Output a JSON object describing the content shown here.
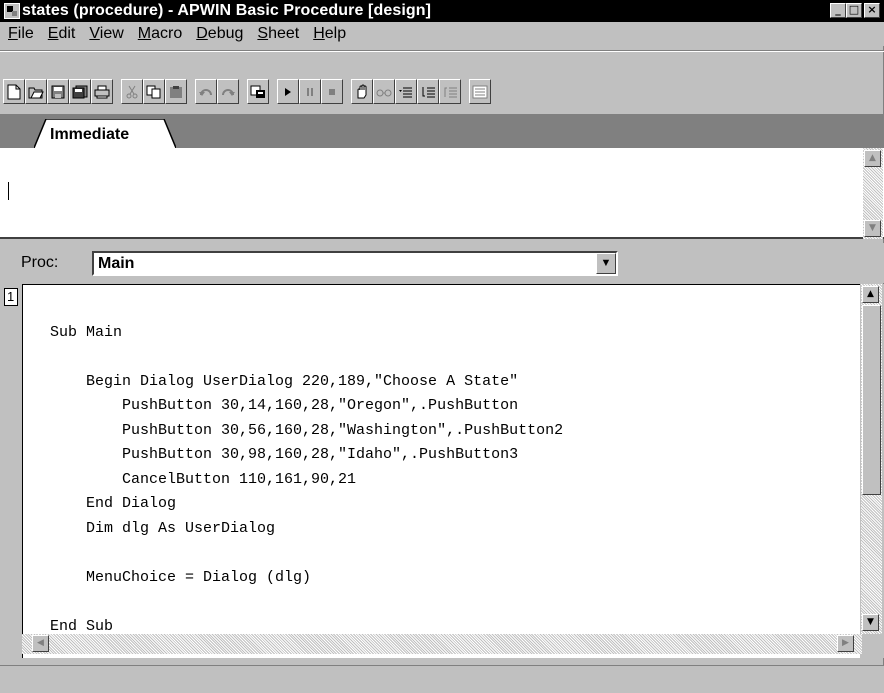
{
  "window": {
    "title": "states (procedure) - APWIN Basic Procedure [design]",
    "controls": {
      "minimize": "_",
      "maximize": "□",
      "close": "×"
    }
  },
  "menu": [
    {
      "label": "File",
      "ul": "F",
      "rest": "ile"
    },
    {
      "label": "Edit",
      "ul": "E",
      "rest": "dit"
    },
    {
      "label": "View",
      "ul": "V",
      "rest": "iew"
    },
    {
      "label": "Macro",
      "ul": "M",
      "rest": "acro"
    },
    {
      "label": "Debug",
      "ul": "D",
      "rest": "ebug"
    },
    {
      "label": "Sheet",
      "ul": "S",
      "rest": "heet"
    },
    {
      "label": "Help",
      "ul": "H",
      "rest": "elp"
    }
  ],
  "toolbar": {
    "icons": [
      "new-icon",
      "open-icon",
      "save-icon",
      "save-all-icon",
      "print-icon",
      "cut-icon",
      "copy-icon",
      "paste-icon",
      "undo-icon",
      "redo-icon",
      "dialog-editor-icon",
      "run-icon",
      "pause-icon",
      "stop-icon",
      "toggle-breakpoint-icon",
      "quick-watch-icon",
      "step-into-icon",
      "step-over-icon",
      "step-out-icon",
      "calls-icon"
    ]
  },
  "tabs": [
    {
      "label": "Immediate"
    }
  ],
  "proc": {
    "label": "Proc:",
    "value": "Main"
  },
  "editor": {
    "line_number": "1",
    "lines": [
      "Sub Main",
      "",
      "    Begin Dialog UserDialog 220,189,\"Choose A State\"",
      "        PushButton 30,14,160,28,\"Oregon\",.PushButton",
      "        PushButton 30,56,160,28,\"Washington\",.PushButton2",
      "        PushButton 30,98,160,28,\"Idaho\",.PushButton3",
      "        CancelButton 110,161,90,21",
      "    End Dialog",
      "    Dim dlg As UserDialog",
      "",
      "    MenuChoice = Dialog (dlg)",
      "",
      "End Sub"
    ]
  }
}
